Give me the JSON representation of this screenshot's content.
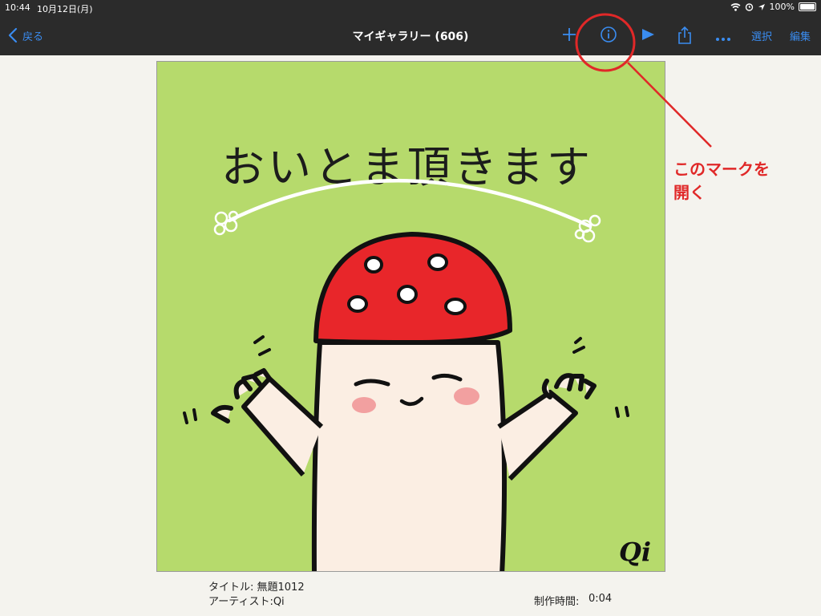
{
  "status_bar": {
    "time": "10:44",
    "date": "10月12日(月)",
    "battery": "100%"
  },
  "nav": {
    "back_label": "戻る",
    "title": "マイギャラリー (606)",
    "select_label": "選択",
    "edit_label": "編集",
    "icons": [
      "chevron-left-icon",
      "plus-icon",
      "info-icon",
      "play-icon",
      "share-icon",
      "more-icon"
    ]
  },
  "artwork": {
    "caption": "おいとま頂きます",
    "signature": "Qi"
  },
  "info": {
    "title": "タイトル: 無題1012",
    "artist": "アーティスト:Qi",
    "time_label": "制作時間:",
    "time_value": "0:04"
  },
  "annotation": {
    "line1": "このマークを",
    "line2": "開く",
    "color": "#e02828"
  },
  "colors": {
    "accent": "#3a8cf0",
    "toolbar": "#2b2b2b",
    "canvas_bg": "#b6da6c",
    "hat": "#e8262a",
    "body": "#fbeee3",
    "cheek": "#f2a0a0"
  }
}
